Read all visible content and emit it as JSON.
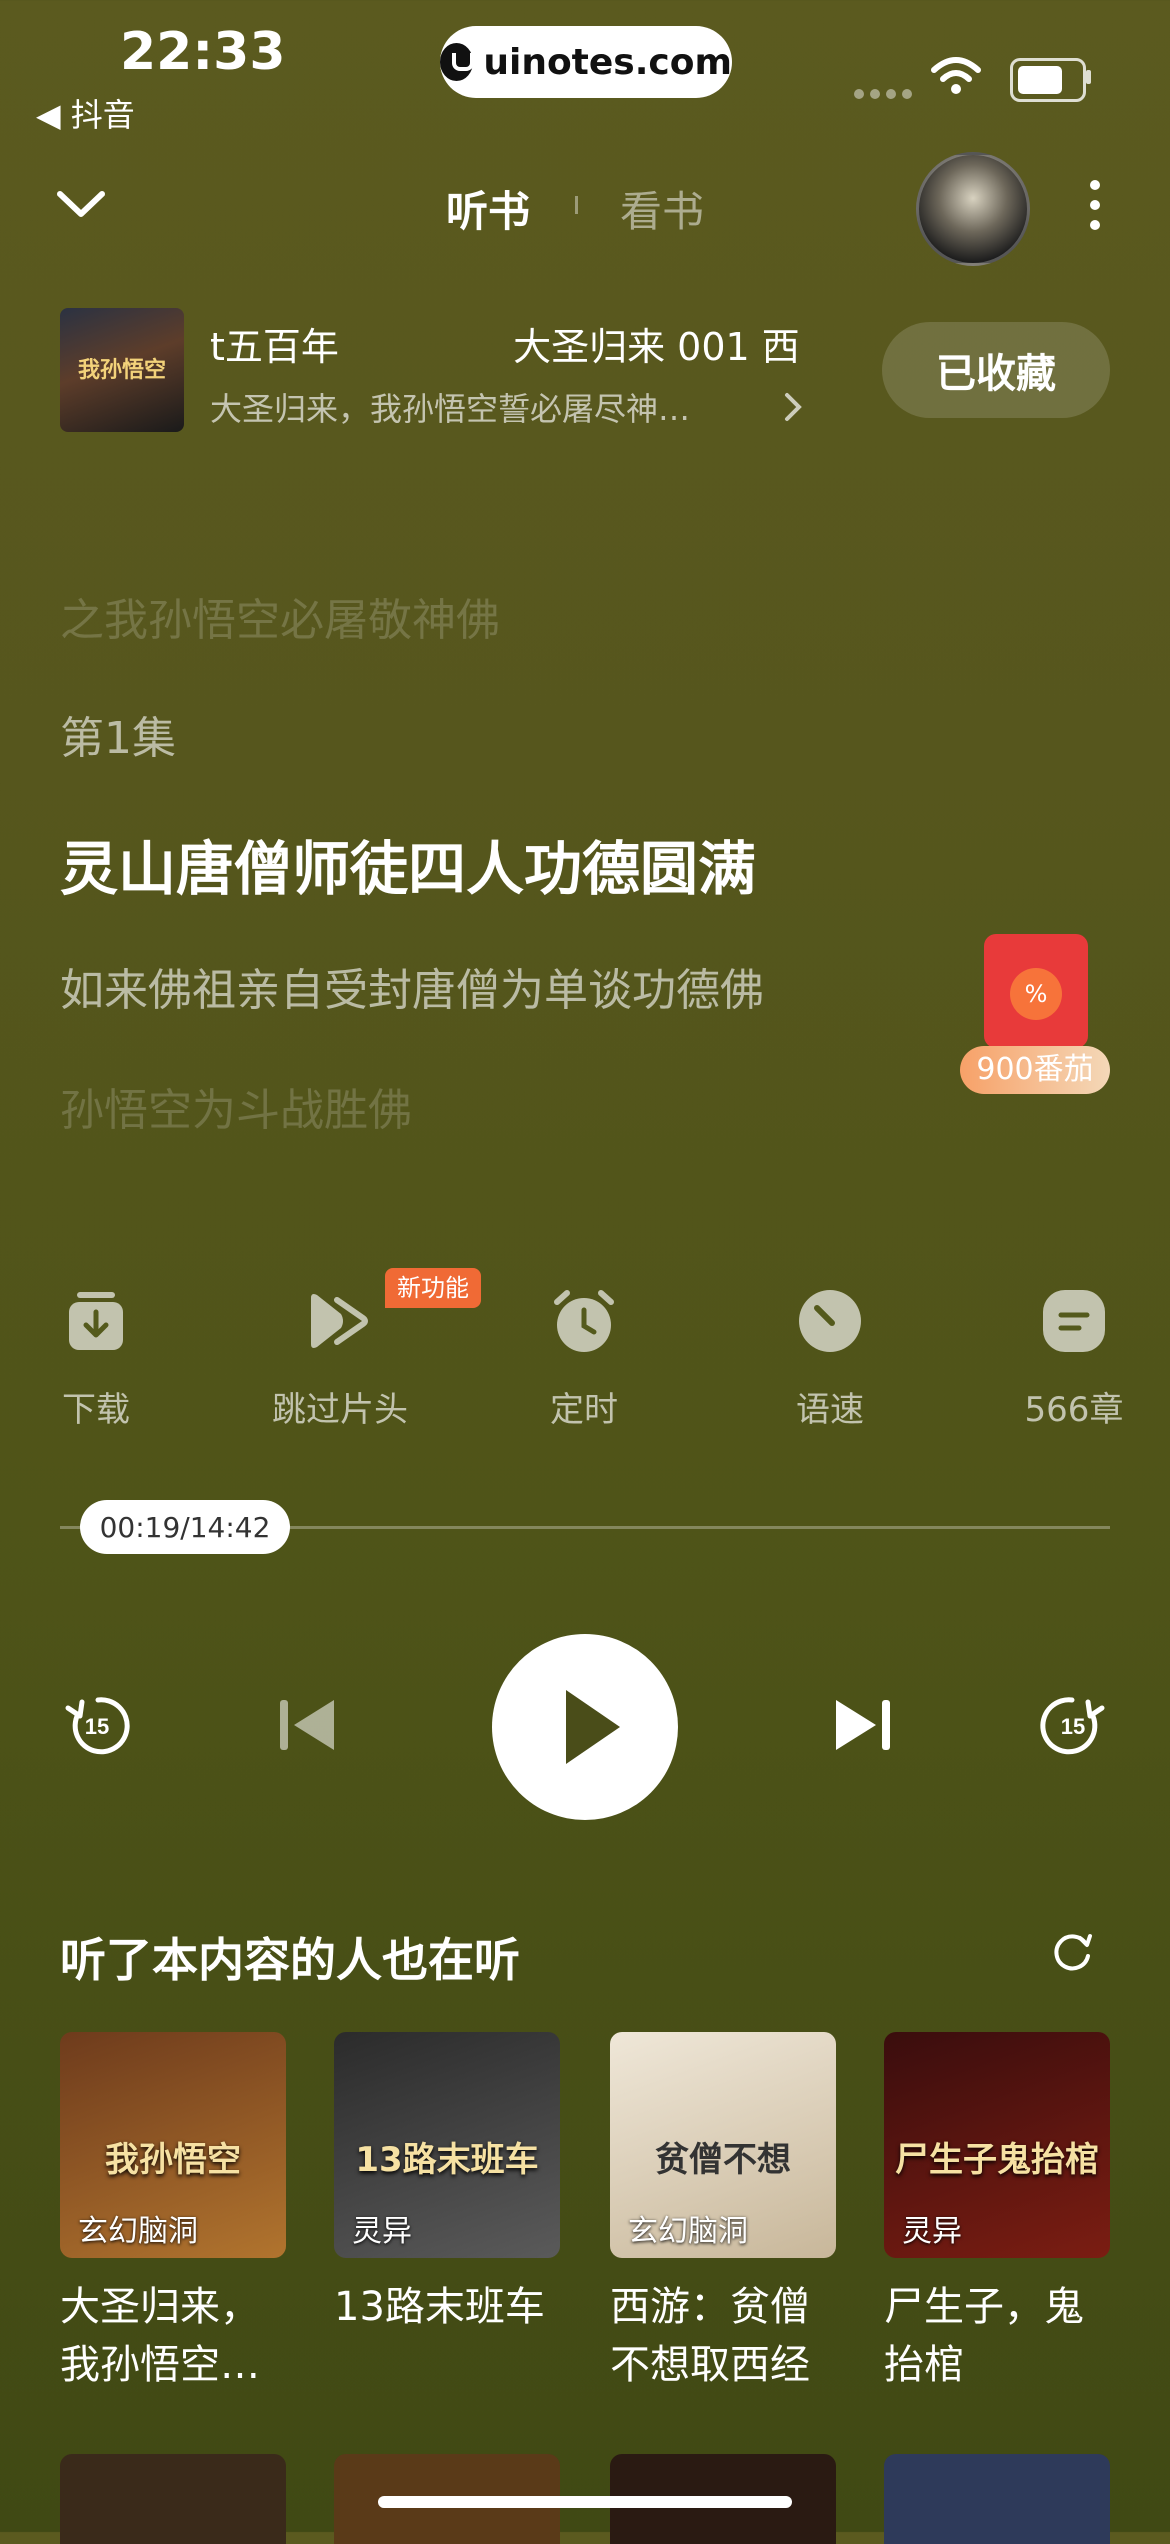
{
  "status": {
    "time": "22:33",
    "back_app": "抖音",
    "url": "uinotes.com"
  },
  "header": {
    "tab_listen": "听书",
    "tab_read": "看书"
  },
  "book": {
    "title_left": "t五百年",
    "title_right": "大圣归来 001 西",
    "subtitle": "大圣归来，我孙悟空誓必屠尽神…",
    "cover_text": "我孙悟空",
    "collect_label": "已收藏"
  },
  "lyrics": {
    "line1": "之我孙悟空必屠敬神佛",
    "line2": "第1集",
    "line3": "灵山唐僧师徒四人功德圆满",
    "line4": "如来佛祖亲自受封唐僧为单谈功德佛",
    "line5": "孙悟空为斗战胜佛"
  },
  "reward": {
    "coin": "%",
    "label": "900番茄"
  },
  "features": [
    {
      "label": "下载",
      "icon": "download-icon"
    },
    {
      "label": "跳过片头",
      "icon": "skip-intro-icon",
      "badge": "新功能"
    },
    {
      "label": "定时",
      "icon": "alarm-clock-icon"
    },
    {
      "label": "语速",
      "icon": "speed-icon"
    },
    {
      "label": "566章",
      "icon": "chapters-icon"
    }
  ],
  "player": {
    "time": "00:19/14:42",
    "progress": 0.022,
    "rewind": "15",
    "forward": "15"
  },
  "recommend": {
    "title": "听了本内容的人也在听",
    "items": [
      {
        "name": "大圣归来，我孙悟空…",
        "tag": "玄幻脑洞",
        "img_text": "我孙悟空",
        "color1": "#6e3b1c",
        "color2": "#b1742e"
      },
      {
        "name": "13路末班车",
        "tag": "灵异",
        "img_text": "13路末班车",
        "color1": "#2b2b2b",
        "color2": "#5a5a5a"
      },
      {
        "name": "西游：贫僧不想取西经",
        "tag": "玄幻脑洞",
        "img_text": "贫僧不想",
        "color1": "#efe7d8",
        "color2": "#c8b79a"
      },
      {
        "name": "尸生子，鬼抬棺",
        "tag": "灵异",
        "img_text": "尸生子鬼抬棺",
        "color1": "#3a0d0d",
        "color2": "#7b1d12"
      }
    ]
  }
}
